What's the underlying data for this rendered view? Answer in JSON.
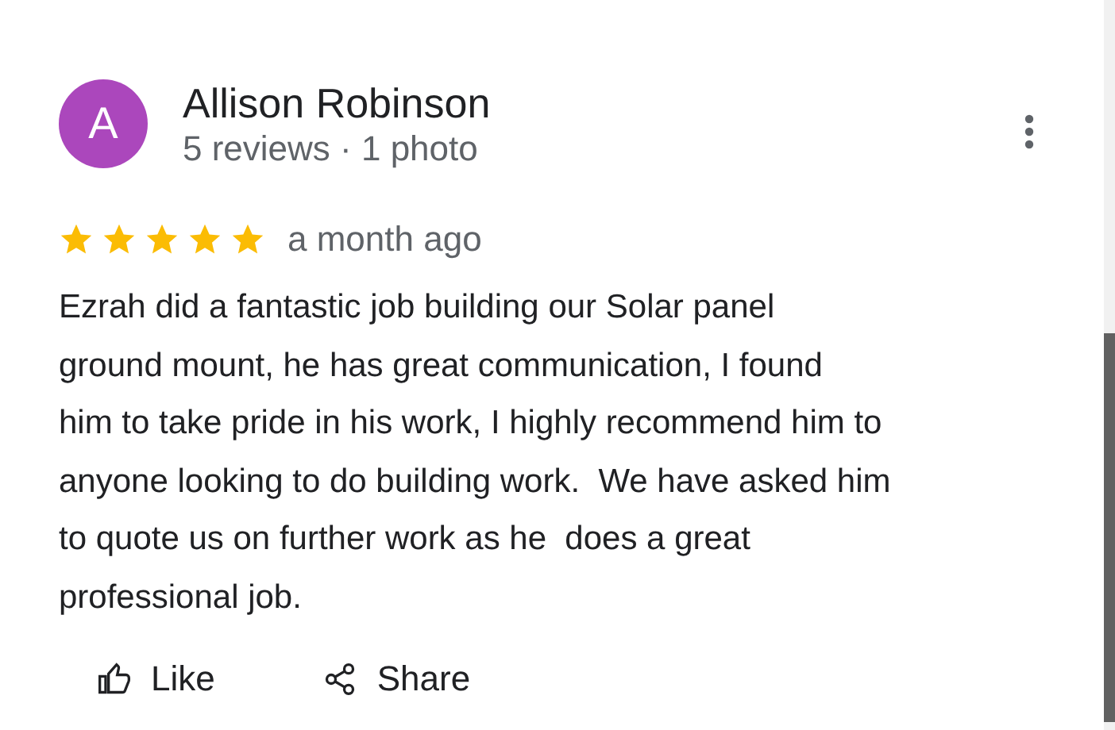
{
  "review": {
    "author": "Allison Robinson",
    "avatar_letter": "A",
    "meta": "5 reviews · 1 photo",
    "stars": 5,
    "time": "a month ago",
    "text": "Ezrah did a fantastic job building our Solar panel\nground mount, he has great communication, I found\nhim to take pride in his work, I highly recommend him to\nanyone looking to do building work.  We have asked him\nto quote us on further work as he  does a great\nprofessional job.",
    "actions": [
      {
        "kind": "like",
        "label": "Like"
      },
      {
        "kind": "share",
        "label": "Share"
      }
    ]
  }
}
